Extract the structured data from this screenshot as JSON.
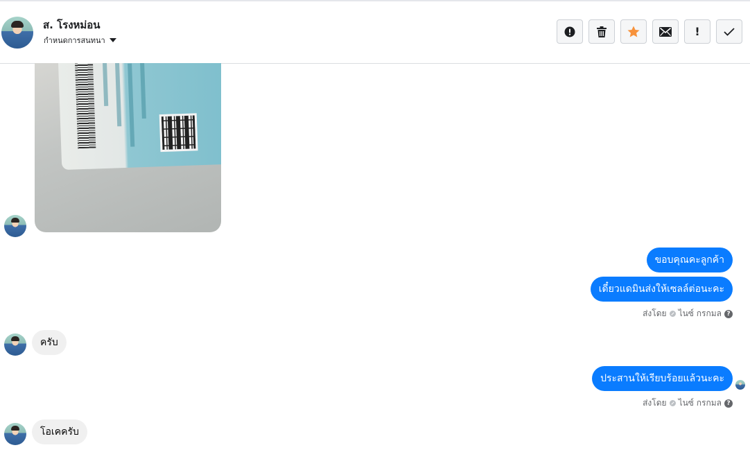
{
  "header": {
    "contact_name": "ส. โรงหม่อน",
    "assign_label": "กำหนดการสนทนา",
    "actions": [
      {
        "name": "spam-button",
        "icon": "alert-circle-icon"
      },
      {
        "name": "delete-button",
        "icon": "trash-icon"
      },
      {
        "name": "star-button",
        "icon": "star-icon",
        "color": "#f7923b"
      },
      {
        "name": "mark-unread-button",
        "icon": "envelope-icon"
      },
      {
        "name": "follow-up-button",
        "icon": "exclamation-icon",
        "glyph": "!"
      },
      {
        "name": "mark-done-button",
        "icon": "check-icon"
      }
    ]
  },
  "messages": [
    {
      "direction": "incoming",
      "type": "image",
      "icon": "id-card-photo"
    },
    {
      "direction": "outgoing",
      "text": "ขอบคุณคะลูกค้า"
    },
    {
      "direction": "outgoing",
      "text": "เดี๋ยวแดมินส่งให้เซลล์ต่อนะคะ"
    },
    {
      "direction": "incoming",
      "text": "ครับ"
    },
    {
      "direction": "outgoing",
      "text": "ประสานให้เรียบร้อยแล้วนะคะ"
    },
    {
      "direction": "incoming",
      "text": "โอเคครับ"
    }
  ],
  "sent_info": {
    "prefix": "ส่งโดย",
    "agent_name": "ไนซ์ กรกมล",
    "help_glyph": "?"
  },
  "colors": {
    "outgoing_bubble": "#0a7cff",
    "incoming_bubble": "#f0f0f0",
    "star": "#f7923b"
  }
}
